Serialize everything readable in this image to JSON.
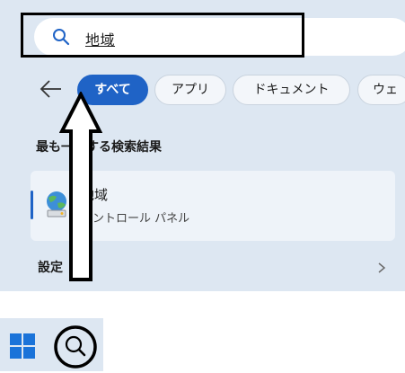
{
  "search": {
    "query": "地域"
  },
  "filters": [
    {
      "label": "すべて",
      "active": true
    },
    {
      "label": "アプリ",
      "active": false
    },
    {
      "label": "ドキュメント",
      "active": false
    },
    {
      "label": "ウェ",
      "active": false
    }
  ],
  "best_match": {
    "section_title": "最も一致する検索結果",
    "title": "地域",
    "subtitle": "コントロール パネル"
  },
  "settings": {
    "label": "設定"
  },
  "colors": {
    "accent": "#1f63c6",
    "panel_bg": "#dde7f2",
    "annotation": "#000000"
  },
  "icons": [
    "search-icon",
    "back-arrow-icon",
    "control-panel-globe-icon",
    "chevron-right-icon",
    "windows-logo-icon",
    "taskbar-search-icon",
    "annotation-up-arrow"
  ]
}
